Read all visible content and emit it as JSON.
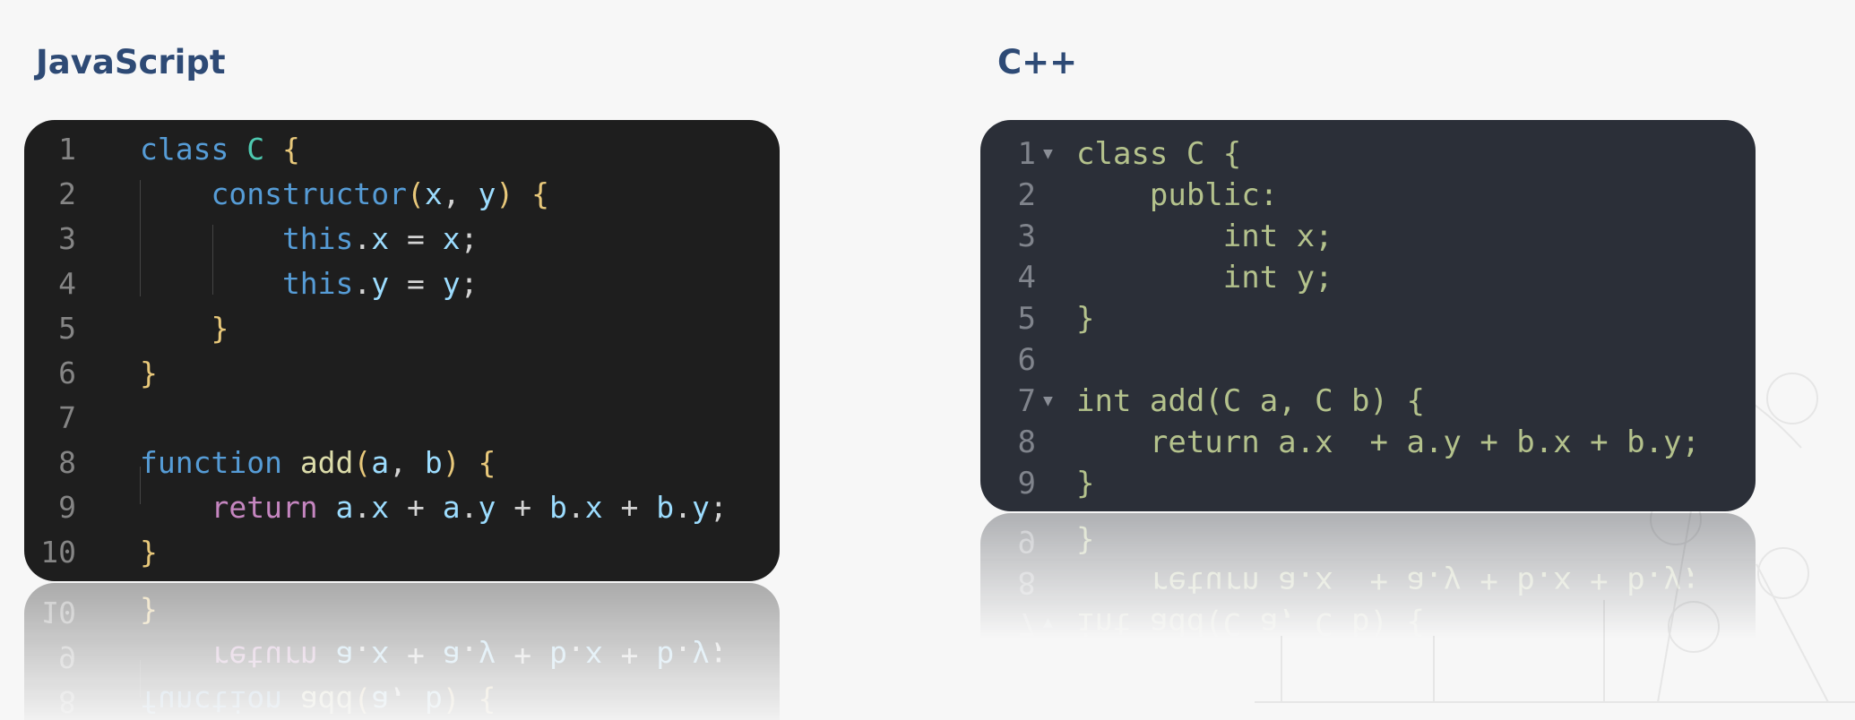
{
  "javascript": {
    "title": "JavaScript",
    "lines": [
      {
        "n": "1",
        "tokens": [
          [
            "kw",
            "class "
          ],
          [
            "cls",
            "C "
          ],
          [
            "br",
            "{"
          ]
        ]
      },
      {
        "n": "2",
        "tokens": [
          [
            "kw",
            "    constructor"
          ],
          [
            "br",
            "("
          ],
          [
            "var",
            "x"
          ],
          [
            "pl",
            ", "
          ],
          [
            "var",
            "y"
          ],
          [
            "br",
            ")"
          ],
          [
            "pl",
            " "
          ],
          [
            "br",
            "{"
          ]
        ]
      },
      {
        "n": "3",
        "tokens": [
          [
            "this",
            "        this"
          ],
          [
            "pl",
            "."
          ],
          [
            "var",
            "x"
          ],
          [
            "pl",
            " = "
          ],
          [
            "var",
            "x"
          ],
          [
            "pl",
            ";"
          ]
        ]
      },
      {
        "n": "4",
        "tokens": [
          [
            "this",
            "        this"
          ],
          [
            "pl",
            "."
          ],
          [
            "var",
            "y"
          ],
          [
            "pl",
            " = "
          ],
          [
            "var",
            "y"
          ],
          [
            "pl",
            ";"
          ]
        ]
      },
      {
        "n": "5",
        "tokens": [
          [
            "br",
            "    }"
          ]
        ]
      },
      {
        "n": "6",
        "tokens": [
          [
            "br",
            "}"
          ]
        ]
      },
      {
        "n": "7",
        "tokens": []
      },
      {
        "n": "8",
        "tokens": [
          [
            "kw",
            "function "
          ],
          [
            "fn",
            "add"
          ],
          [
            "br",
            "("
          ],
          [
            "var",
            "a"
          ],
          [
            "pl",
            ", "
          ],
          [
            "var",
            "b"
          ],
          [
            "br",
            ")"
          ],
          [
            "pl",
            " "
          ],
          [
            "br",
            "{"
          ]
        ]
      },
      {
        "n": "9",
        "tokens": [
          [
            "ret",
            "    return "
          ],
          [
            "var",
            "a"
          ],
          [
            "pl",
            "."
          ],
          [
            "var",
            "x"
          ],
          [
            "pl",
            " + "
          ],
          [
            "var",
            "a"
          ],
          [
            "pl",
            "."
          ],
          [
            "var",
            "y"
          ],
          [
            "pl",
            " + "
          ],
          [
            "var",
            "b"
          ],
          [
            "pl",
            "."
          ],
          [
            "var",
            "x"
          ],
          [
            "pl",
            " + "
          ],
          [
            "var",
            "b"
          ],
          [
            "pl",
            "."
          ],
          [
            "var",
            "y"
          ],
          [
            "pl",
            ";"
          ]
        ]
      },
      {
        "n": "10",
        "tokens": [
          [
            "br",
            "}"
          ]
        ]
      }
    ],
    "colors": {
      "background": "#1e1e1e",
      "keyword": "#569cd6",
      "class": "#4ec9b0",
      "function": "#dcdcaa",
      "return": "#c586c0",
      "variable": "#9cdcfe"
    }
  },
  "cpp": {
    "title": "C++",
    "lines": [
      {
        "n": "1",
        "fold": true,
        "text": "class C {"
      },
      {
        "n": "2",
        "fold": false,
        "text": "    public:"
      },
      {
        "n": "3",
        "fold": false,
        "text": "        int x;"
      },
      {
        "n": "4",
        "fold": false,
        "text": "        int y;"
      },
      {
        "n": "5",
        "fold": false,
        "text": "}"
      },
      {
        "n": "6",
        "fold": false,
        "text": ""
      },
      {
        "n": "7",
        "fold": true,
        "text": "int add(C a, C b) {"
      },
      {
        "n": "8",
        "fold": false,
        "text": "    return a.x  + a.y + b.x + b.y;"
      },
      {
        "n": "9",
        "fold": false,
        "text": "}"
      }
    ],
    "fold_icon": "triangle-down-icon",
    "colors": {
      "background": "#2b2f38",
      "text": "#b4c28c"
    }
  }
}
